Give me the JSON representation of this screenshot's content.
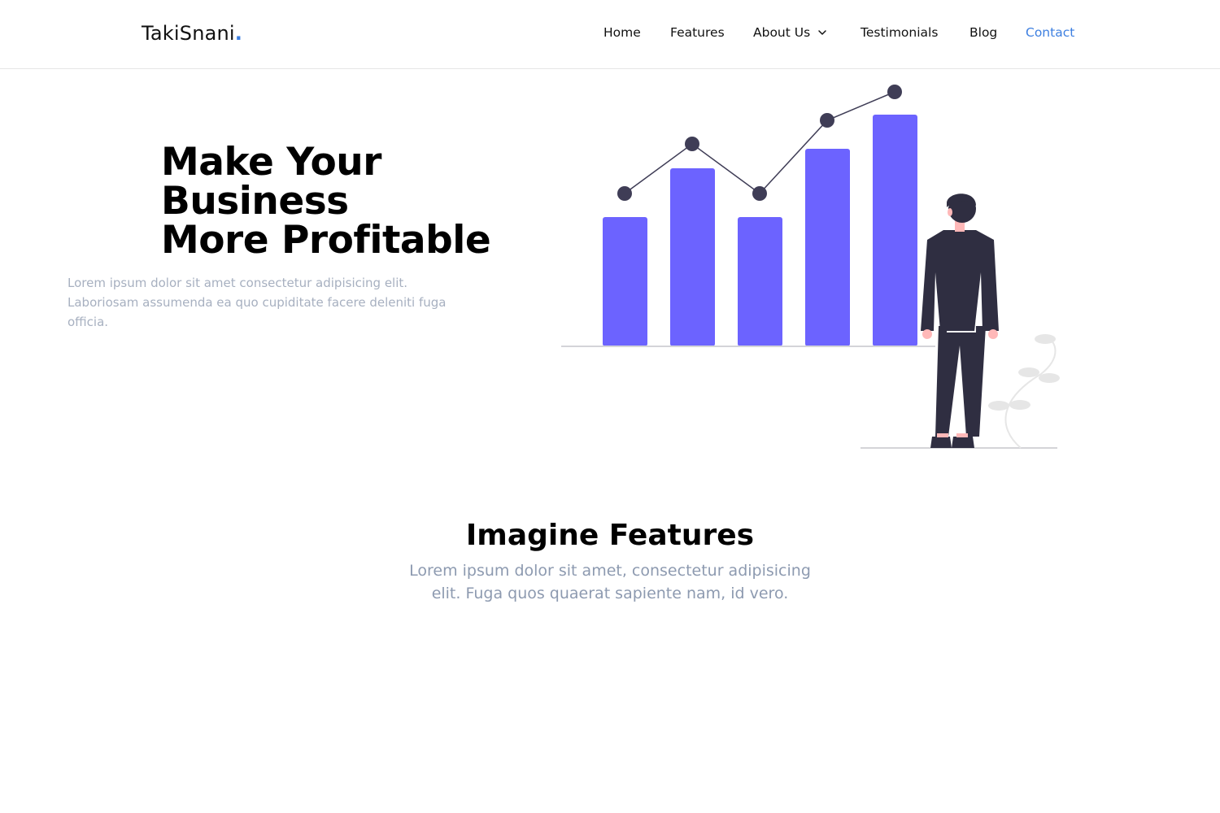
{
  "brand": {
    "name": "TakiSnani",
    "dot": "."
  },
  "nav": {
    "items": [
      {
        "label": "Home"
      },
      {
        "label": "Features"
      },
      {
        "label": "About Us"
      },
      {
        "label": "Testimonials"
      },
      {
        "label": "Blog"
      },
      {
        "label": "Contact"
      }
    ],
    "active": "Contact",
    "active_color": "#3d7fe0"
  },
  "hero": {
    "title_lines": [
      "Make Your",
      "Business",
      "More Profitable"
    ],
    "text": "Lorem ipsum dolor sit amet consectetur adipisicing elit. Laboriosam assumenda ea quo cupiditate facere deleniti fuga officia."
  },
  "illustration": {
    "icon": "growth-chart-with-person",
    "bar_color": "#6c63ff",
    "dark_color": "#3f3d56",
    "bar_values": [
      53,
      73,
      53,
      81,
      95
    ]
  },
  "features": {
    "title": "Imagine Features",
    "text": "Lorem ipsum dolor sit amet, consectetur adipisicing elit. Fuga quos quaerat sapiente nam, id vero."
  }
}
